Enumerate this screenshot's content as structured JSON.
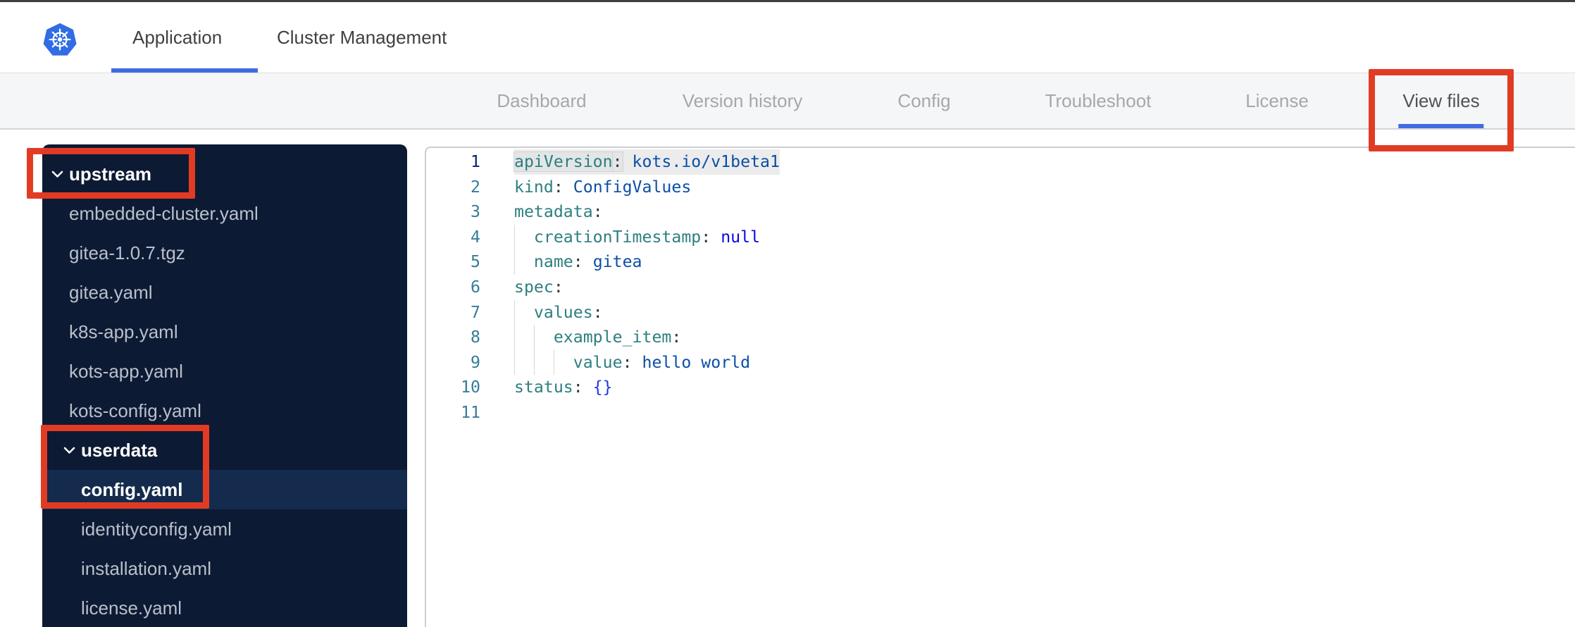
{
  "header": {
    "tabs": [
      {
        "label": "Application",
        "active": true
      },
      {
        "label": "Cluster Management",
        "active": false
      }
    ]
  },
  "nav": {
    "items": [
      {
        "label": "Dashboard",
        "active": false
      },
      {
        "label": "Version history",
        "active": false
      },
      {
        "label": "Config",
        "active": false
      },
      {
        "label": "Troubleshoot",
        "active": false
      },
      {
        "label": "License",
        "active": false
      },
      {
        "label": "View files",
        "active": true
      }
    ]
  },
  "file_tree": {
    "items": [
      {
        "label": "upstream",
        "kind": "folder",
        "level": 0,
        "expanded": true,
        "selected": false
      },
      {
        "label": "embedded-cluster.yaml",
        "kind": "file",
        "level": 0,
        "selected": false
      },
      {
        "label": "gitea-1.0.7.tgz",
        "kind": "file",
        "level": 0,
        "selected": false
      },
      {
        "label": "gitea.yaml",
        "kind": "file",
        "level": 0,
        "selected": false
      },
      {
        "label": "k8s-app.yaml",
        "kind": "file",
        "level": 0,
        "selected": false
      },
      {
        "label": "kots-app.yaml",
        "kind": "file",
        "level": 0,
        "selected": false
      },
      {
        "label": "kots-config.yaml",
        "kind": "file",
        "level": 0,
        "selected": false
      },
      {
        "label": "userdata",
        "kind": "folder",
        "level": 1,
        "expanded": true,
        "selected": false
      },
      {
        "label": "config.yaml",
        "kind": "file",
        "level": 1,
        "selected": true
      },
      {
        "label": "identityconfig.yaml",
        "kind": "file",
        "level": 1,
        "selected": false
      },
      {
        "label": "installation.yaml",
        "kind": "file",
        "level": 1,
        "selected": false
      },
      {
        "label": "license.yaml",
        "kind": "file",
        "level": 1,
        "selected": false
      }
    ]
  },
  "editor": {
    "language": "yaml",
    "open_file": "config.yaml",
    "lines": [
      {
        "num": 1,
        "indent": 0,
        "current": true,
        "tokens": [
          {
            "cls": "tok-key word-hl",
            "text": "apiVersion"
          },
          {
            "cls": "tok-colon word-hl",
            "text": ":"
          },
          {
            "cls": "plain",
            "text": " "
          },
          {
            "cls": "tok-val",
            "text": "kots.io/v1beta1"
          }
        ]
      },
      {
        "num": 2,
        "indent": 0,
        "current": false,
        "tokens": [
          {
            "cls": "tok-key",
            "text": "kind"
          },
          {
            "cls": "tok-colon",
            "text": ":"
          },
          {
            "cls": "plain",
            "text": " "
          },
          {
            "cls": "tok-val",
            "text": "ConfigValues"
          }
        ]
      },
      {
        "num": 3,
        "indent": 0,
        "current": false,
        "tokens": [
          {
            "cls": "tok-key",
            "text": "metadata"
          },
          {
            "cls": "tok-colon",
            "text": ":"
          }
        ]
      },
      {
        "num": 4,
        "indent": 2,
        "current": false,
        "tokens": [
          {
            "cls": "plain",
            "text": "  "
          },
          {
            "cls": "tok-key",
            "text": "creationTimestamp"
          },
          {
            "cls": "tok-colon",
            "text": ":"
          },
          {
            "cls": "plain",
            "text": " "
          },
          {
            "cls": "tok-kw",
            "text": "null"
          }
        ]
      },
      {
        "num": 5,
        "indent": 2,
        "current": false,
        "tokens": [
          {
            "cls": "plain",
            "text": "  "
          },
          {
            "cls": "tok-key",
            "text": "name"
          },
          {
            "cls": "tok-colon",
            "text": ":"
          },
          {
            "cls": "plain",
            "text": " "
          },
          {
            "cls": "tok-val",
            "text": "gitea"
          }
        ]
      },
      {
        "num": 6,
        "indent": 0,
        "current": false,
        "tokens": [
          {
            "cls": "tok-key",
            "text": "spec"
          },
          {
            "cls": "tok-colon",
            "text": ":"
          }
        ]
      },
      {
        "num": 7,
        "indent": 2,
        "current": false,
        "tokens": [
          {
            "cls": "plain",
            "text": "  "
          },
          {
            "cls": "tok-key",
            "text": "values"
          },
          {
            "cls": "tok-colon",
            "text": ":"
          }
        ]
      },
      {
        "num": 8,
        "indent": 4,
        "current": false,
        "tokens": [
          {
            "cls": "plain",
            "text": "    "
          },
          {
            "cls": "tok-key",
            "text": "example_item"
          },
          {
            "cls": "tok-colon",
            "text": ":"
          }
        ]
      },
      {
        "num": 9,
        "indent": 6,
        "current": false,
        "tokens": [
          {
            "cls": "plain",
            "text": "      "
          },
          {
            "cls": "tok-key",
            "text": "value"
          },
          {
            "cls": "tok-colon",
            "text": ":"
          },
          {
            "cls": "plain",
            "text": " "
          },
          {
            "cls": "tok-val",
            "text": "hello world"
          }
        ]
      },
      {
        "num": 10,
        "indent": 0,
        "current": false,
        "tokens": [
          {
            "cls": "tok-key",
            "text": "status"
          },
          {
            "cls": "tok-colon",
            "text": ":"
          },
          {
            "cls": "plain",
            "text": " "
          },
          {
            "cls": "tok-br",
            "text": "{}"
          }
        ]
      },
      {
        "num": 11,
        "indent": 0,
        "current": false,
        "tokens": []
      }
    ]
  },
  "annotations": {
    "boxes": [
      {
        "target": "view-files-tab"
      },
      {
        "target": "upstream-folder"
      },
      {
        "target": "userdata-folder-and-config-yaml"
      }
    ]
  },
  "colors": {
    "accent-blue": "#416ce1",
    "logo-blue": "#326ce5",
    "annotation-red": "#e23b24",
    "sidebar-bg": "#0d1a33",
    "sidebar-selected": "#142b4d",
    "tok-key": "#2e7f80",
    "tok-val": "#0b4fa5",
    "tok-kw": "#0b06df",
    "tok-br": "#2336e0",
    "line-num": "#347d99",
    "line-num-active": "#0b216f"
  }
}
